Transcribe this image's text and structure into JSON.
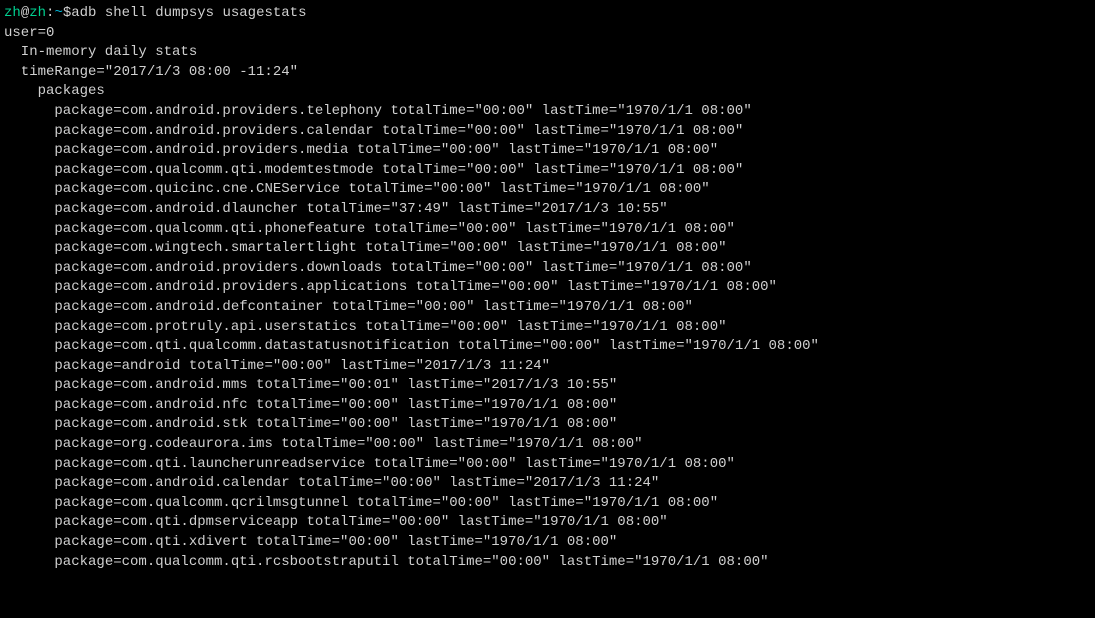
{
  "prompt": {
    "user": "zh",
    "host": "zh",
    "path": "~",
    "symbol": "$"
  },
  "command": "adb shell dumpsys usagestats",
  "header": {
    "user_line": "user=0",
    "stats_title": "In-memory daily stats",
    "time_range": "timeRange=\"2017/1/3 08:00 -11:24\"",
    "packages_label": "packages"
  },
  "packages": [
    {
      "name": "com.android.providers.telephony",
      "totalTime": "00:00",
      "lastTime": "1970/1/1 08:00"
    },
    {
      "name": "com.android.providers.calendar",
      "totalTime": "00:00",
      "lastTime": "1970/1/1 08:00"
    },
    {
      "name": "com.android.providers.media",
      "totalTime": "00:00",
      "lastTime": "1970/1/1 08:00"
    },
    {
      "name": "com.qualcomm.qti.modemtestmode",
      "totalTime": "00:00",
      "lastTime": "1970/1/1 08:00"
    },
    {
      "name": "com.quicinc.cne.CNEService",
      "totalTime": "00:00",
      "lastTime": "1970/1/1 08:00"
    },
    {
      "name": "com.android.dlauncher",
      "totalTime": "37:49",
      "lastTime": "2017/1/3 10:55"
    },
    {
      "name": "com.qualcomm.qti.phonefeature",
      "totalTime": "00:00",
      "lastTime": "1970/1/1 08:00"
    },
    {
      "name": "com.wingtech.smartalertlight",
      "totalTime": "00:00",
      "lastTime": "1970/1/1 08:00"
    },
    {
      "name": "com.android.providers.downloads",
      "totalTime": "00:00",
      "lastTime": "1970/1/1 08:00"
    },
    {
      "name": "com.android.providers.applications",
      "totalTime": "00:00",
      "lastTime": "1970/1/1 08:00"
    },
    {
      "name": "com.android.defcontainer",
      "totalTime": "00:00",
      "lastTime": "1970/1/1 08:00"
    },
    {
      "name": "com.protruly.api.userstatics",
      "totalTime": "00:00",
      "lastTime": "1970/1/1 08:00"
    },
    {
      "name": "com.qti.qualcomm.datastatusnotification",
      "totalTime": "00:00",
      "lastTime": "1970/1/1 08:00"
    },
    {
      "name": "android",
      "totalTime": "00:00",
      "lastTime": "2017/1/3 11:24"
    },
    {
      "name": "com.android.mms",
      "totalTime": "00:01",
      "lastTime": "2017/1/3 10:55"
    },
    {
      "name": "com.android.nfc",
      "totalTime": "00:00",
      "lastTime": "1970/1/1 08:00"
    },
    {
      "name": "com.android.stk",
      "totalTime": "00:00",
      "lastTime": "1970/1/1 08:00"
    },
    {
      "name": "org.codeaurora.ims",
      "totalTime": "00:00",
      "lastTime": "1970/1/1 08:00"
    },
    {
      "name": "com.qti.launcherunreadservice",
      "totalTime": "00:00",
      "lastTime": "1970/1/1 08:00"
    },
    {
      "name": "com.android.calendar",
      "totalTime": "00:00",
      "lastTime": "2017/1/3 11:24"
    },
    {
      "name": "com.qualcomm.qcrilmsgtunnel",
      "totalTime": "00:00",
      "lastTime": "1970/1/1 08:00"
    },
    {
      "name": "com.qti.dpmserviceapp",
      "totalTime": "00:00",
      "lastTime": "1970/1/1 08:00"
    },
    {
      "name": "com.qti.xdivert",
      "totalTime": "00:00",
      "lastTime": "1970/1/1 08:00"
    },
    {
      "name": "com.qualcomm.qti.rcsbootstraputil",
      "totalTime": "00:00",
      "lastTime": "1970/1/1 08:00"
    }
  ]
}
